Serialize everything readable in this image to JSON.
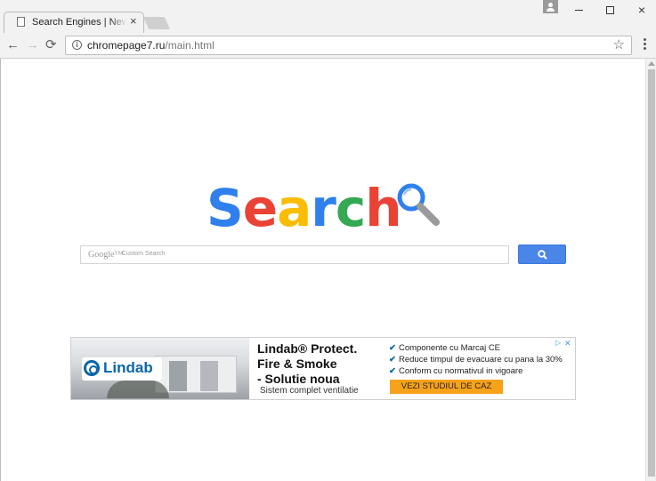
{
  "tab": {
    "title": "Search Engines | News search",
    "close": "×"
  },
  "window": {
    "minimize": "",
    "maximize": "",
    "close": "×"
  },
  "toolbar": {
    "back": "←",
    "forward": "→",
    "reload": "⟳",
    "url_host": "chromepage7.ru",
    "url_path": "/main.html",
    "info": "i",
    "star": "☆"
  },
  "logo": {
    "letters": [
      "S",
      "e",
      "a",
      "r",
      "c",
      "h"
    ],
    "colors": [
      "#2f80ec",
      "#ea4335",
      "#fbbc05",
      "#2f80ec",
      "#34a853",
      "#ea4335"
    ]
  },
  "search": {
    "google_mark": "Google™",
    "placeholder": "Custom Search"
  },
  "ad": {
    "brand": "Lindab",
    "headline_1": "Lindab® Protect.",
    "headline_2": "Fire & Smoke",
    "headline_3": "- Solutie noua",
    "subline": "Sistem complet ventilatie",
    "bullets": [
      "Componente cu Marcaj CE",
      "Reduce timpul de evacuare cu pana la 30%",
      "Conform cu normativul in vigoare"
    ],
    "cta": "VEZI STUDIUL DE CAZ",
    "adchoices_play": "▷",
    "adchoices_x": "✕"
  },
  "colors": {
    "accent": "#4a86e8",
    "cta": "#f7a21b",
    "brand_blue": "#0a66a8"
  }
}
